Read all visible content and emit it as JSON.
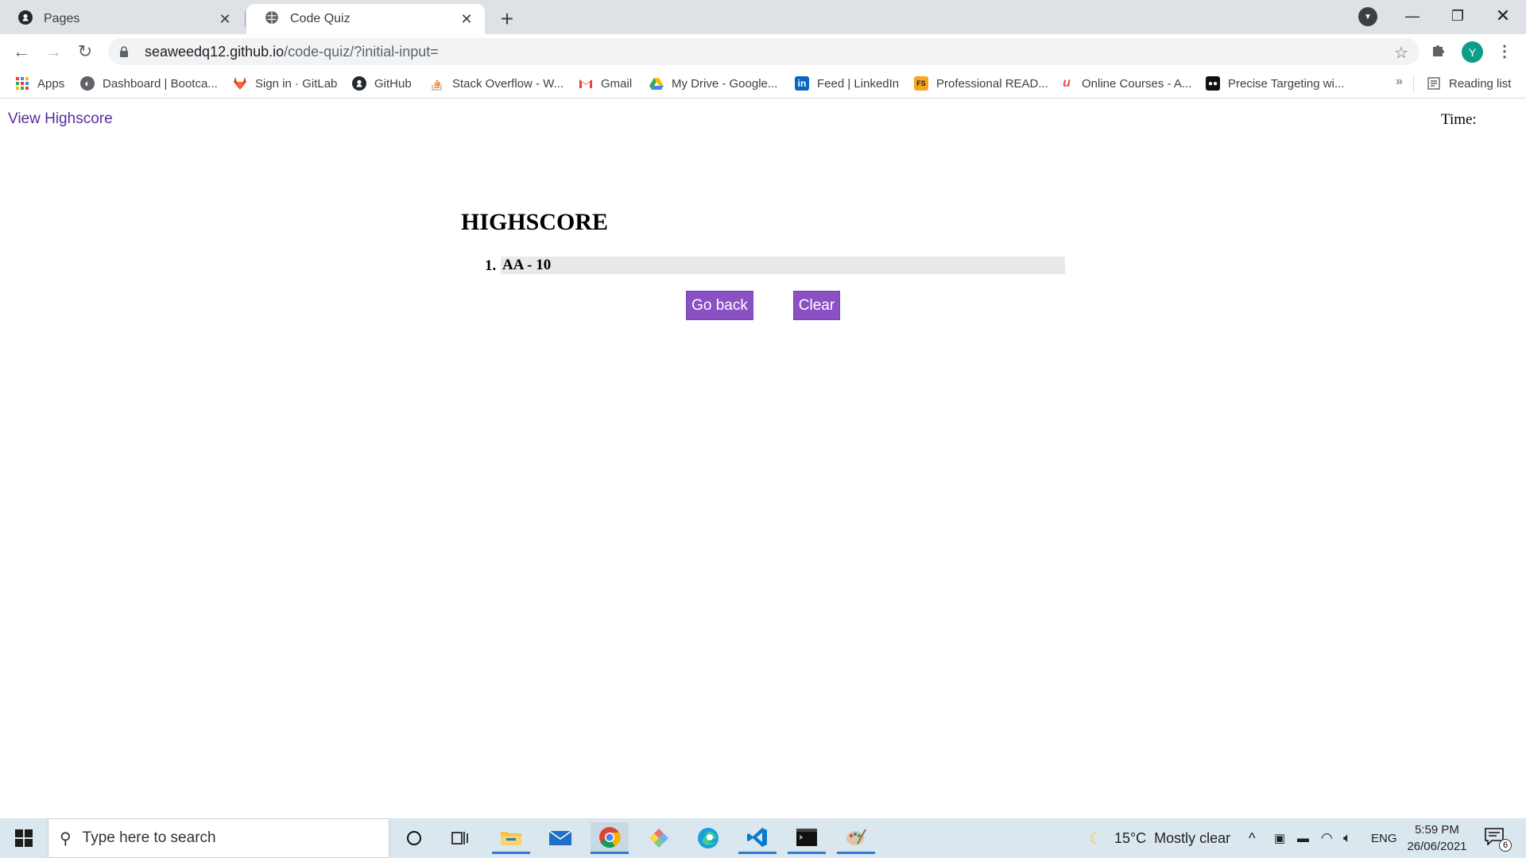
{
  "browser": {
    "tabs": [
      {
        "title": "Pages",
        "icon": "github-icon",
        "active": false
      },
      {
        "title": "Code Quiz",
        "icon": "globe-icon",
        "active": true
      }
    ],
    "address": {
      "host": "seaweedq12.github.io",
      "path": "/code-quiz/?initial-input="
    },
    "avatar_letter": "Y",
    "bookmarks": [
      {
        "label": "Apps",
        "icon": "apps-grid-icon"
      },
      {
        "label": "Dashboard | Bootca...",
        "icon": "globe-icon"
      },
      {
        "label": "Sign in · GitLab",
        "icon": "gitlab-icon"
      },
      {
        "label": "GitHub",
        "icon": "github-icon"
      },
      {
        "label": "Stack Overflow - W...",
        "icon": "stackoverflow-icon"
      },
      {
        "label": "Gmail",
        "icon": "gmail-icon"
      },
      {
        "label": "My Drive - Google...",
        "icon": "google-drive-icon"
      },
      {
        "label": "Feed | LinkedIn",
        "icon": "linkedin-icon"
      },
      {
        "label": "Professional READ...",
        "icon": "fs-icon"
      },
      {
        "label": "Online Courses - A...",
        "icon": "udemy-icon"
      },
      {
        "label": "Precise Targeting wi...",
        "icon": "targeting-icon"
      }
    ],
    "more_bookmarks": "»",
    "reading_list": "Reading list"
  },
  "page": {
    "view_highscore_link": "View Highscore",
    "time_label": "Time:",
    "time_value": "",
    "title": "HIGHSCORE",
    "scores": [
      {
        "rank": "1.",
        "entry": "AA - 10"
      }
    ],
    "go_back_label": "Go back",
    "clear_label": "Clear"
  },
  "taskbar": {
    "search_placeholder": "Type here to search",
    "weather": "15°C  Mostly clear",
    "language": "ENG",
    "time": "5:59 PM",
    "date": "26/06/2021",
    "notification_count": "6"
  },
  "colors": {
    "button_bg": "#8a50c4",
    "link": "#5a2a9a",
    "score_row_bg": "#e9e9e9"
  }
}
